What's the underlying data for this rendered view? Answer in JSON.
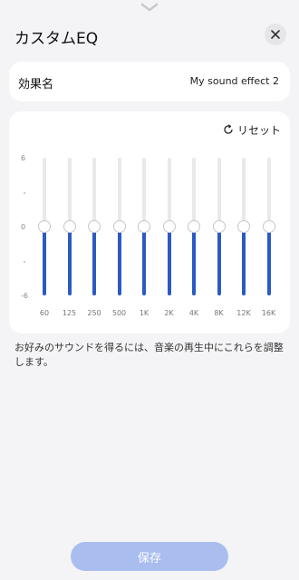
{
  "header": {
    "title": "カスタムEQ"
  },
  "effect_name": {
    "label": "効果名",
    "value": "My sound effect 2"
  },
  "reset": {
    "label": "リセット"
  },
  "eq": {
    "y_labels": [
      "6",
      "0",
      "-6"
    ],
    "bands": [
      {
        "freq": "60",
        "gain": 0
      },
      {
        "freq": "125",
        "gain": 0
      },
      {
        "freq": "250",
        "gain": 0
      },
      {
        "freq": "500",
        "gain": 0
      },
      {
        "freq": "1K",
        "gain": 0
      },
      {
        "freq": "2K",
        "gain": 0
      },
      {
        "freq": "4K",
        "gain": 0
      },
      {
        "freq": "8K",
        "gain": 0
      },
      {
        "freq": "12K",
        "gain": 0
      },
      {
        "freq": "16K",
        "gain": 0
      }
    ]
  },
  "hint": "お好みのサウンドを得るには、音楽の再生中にこれらを調整します。",
  "save": {
    "label": "保存"
  },
  "colors": {
    "accent": "#2c5ac3",
    "save_disabled": "#a9bdef",
    "background": "#f4f4f6"
  }
}
